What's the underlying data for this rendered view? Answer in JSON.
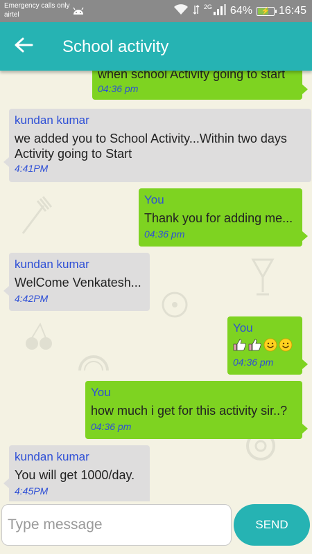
{
  "status_bar": {
    "carrier_line1": "Emergency calls only",
    "carrier_line2": "airtel",
    "network_type": "2G",
    "battery": "64%",
    "time": "16:45"
  },
  "toolbar": {
    "title": "School activity",
    "back_icon": "arrow-left-icon"
  },
  "messages": [
    {
      "direction": "outgoing",
      "sender": "",
      "text": "when school Activity going to start",
      "time": "04:36 pm"
    },
    {
      "direction": "incoming",
      "sender": "kundan kumar",
      "text_lines": [
        "we added you to School Activity...Within two days",
        "Activity going to Start"
      ],
      "time": "4:41PM"
    },
    {
      "direction": "outgoing",
      "sender": "You",
      "text": "Thank you for adding me...",
      "time": "04:36 pm"
    },
    {
      "direction": "incoming",
      "sender": "kundan kumar",
      "text": "WelCome Venkatesh...",
      "time": "4:42PM"
    },
    {
      "direction": "outgoing",
      "sender": "You",
      "emojis": [
        "thumbs-up-icon",
        "thumbs-up-icon",
        "smiley-icon",
        "smiley-icon"
      ],
      "time": "04:36 pm"
    },
    {
      "direction": "outgoing",
      "sender": "You",
      "text": "how much i get for this activity sir..?",
      "time": "04:36 pm"
    },
    {
      "direction": "incoming",
      "sender": "kundan kumar",
      "text": "You will get 1000/day.",
      "time": "4:45PM"
    }
  ],
  "composer": {
    "placeholder": "Type message",
    "value": "",
    "send_label": "SEND"
  },
  "colors": {
    "accent": "#26b3b3",
    "outgoing_bubble": "#7ed321",
    "incoming_bubble": "#dedddd",
    "sender_text": "#2e4fd6",
    "background": "#f4f2e3"
  }
}
